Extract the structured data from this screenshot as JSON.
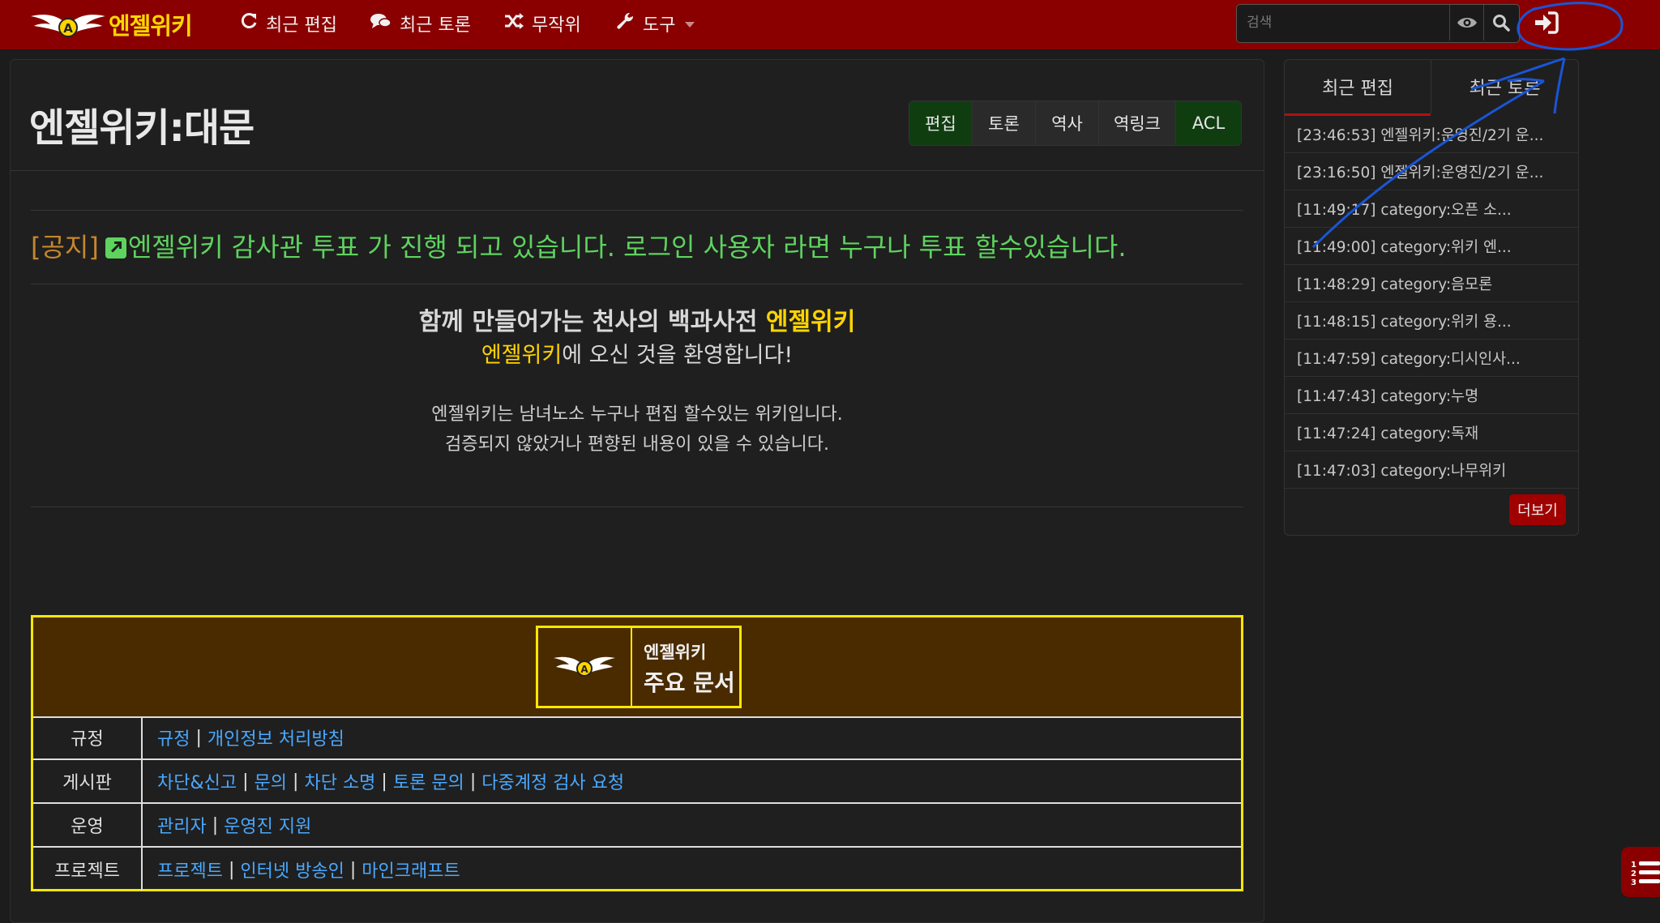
{
  "header": {
    "logo_text": "엔젤위키",
    "nav": [
      {
        "label": "최근 편집",
        "icon": "refresh-icon"
      },
      {
        "label": "최근 토론",
        "icon": "comments-icon"
      },
      {
        "label": "무작위",
        "icon": "shuffle-icon"
      },
      {
        "label": "도구",
        "icon": "wrench-icon"
      }
    ],
    "search_placeholder": "검색"
  },
  "page": {
    "title": "엔젤위키:대문",
    "actions": [
      "편집",
      "토론",
      "역사",
      "역링크",
      "ACL"
    ]
  },
  "notice": {
    "tag": "[공지]",
    "text": "엔젤위키 감사관 투표 가 진행 되고 있습니다. 로그인 사용자 라면 누구나 투표 할수있습니다."
  },
  "welcome": {
    "line1_prefix": "함께 만들어가는 천사의 백과사전 ",
    "line1_highlight": "엔젤위키",
    "line2_highlight": "엔젤위키",
    "line2_suffix": "에 오신 것을 환영합니다!",
    "desc1": "엔젤위키는 남녀노소 누구나 편집 할수있는 위키입니다.",
    "desc2": "검증되지 않았거나 편향된 내용이 있을 수 있습니다."
  },
  "main_docs": {
    "box_title_small": "엔젤위키",
    "box_title_large": "주요 문서",
    "rows": [
      {
        "category": "규정",
        "links": [
          "규정",
          "개인정보 처리방침"
        ]
      },
      {
        "category": "게시판",
        "links": [
          "차단&신고",
          "문의",
          "차단 소명",
          "토론 문의",
          "다중계정 검사 요청"
        ]
      },
      {
        "category": "운영",
        "links": [
          "관리자",
          "운영진 지원"
        ]
      },
      {
        "category": "프로젝트",
        "links": [
          "프로젝트",
          "인터넷 방송인",
          "마인크래프트"
        ]
      }
    ],
    "separator": "|"
  },
  "sidebar": {
    "tabs": [
      "최근 편집",
      "최근 토론"
    ],
    "items": [
      "[23:46:53] 엔젤위키:운영진/2기 운...",
      "[23:16:50] 엔젤위키:운영진/2기 운...",
      "[11:49:17] category:오픈 소...",
      "[11:49:00] category:위키 엔...",
      "[11:48:29] category:음모론",
      "[11:48:15] category:위키 용...",
      "[11:47:59] category:디시인사...",
      "[11:47:43] category:누명",
      "[11:47:24] category:독재",
      "[11:47:03] category:나무위키"
    ],
    "more_label": "더보기"
  },
  "colors": {
    "header_bg": "#8a0000",
    "accent_yellow": "#ffd400",
    "notice_green": "#5ed35e",
    "link_blue": "#4aa8ff",
    "edit_green": "#0f3d10",
    "docs_header_bg": "#4a2b00",
    "annotation_blue": "#1a55d6"
  }
}
